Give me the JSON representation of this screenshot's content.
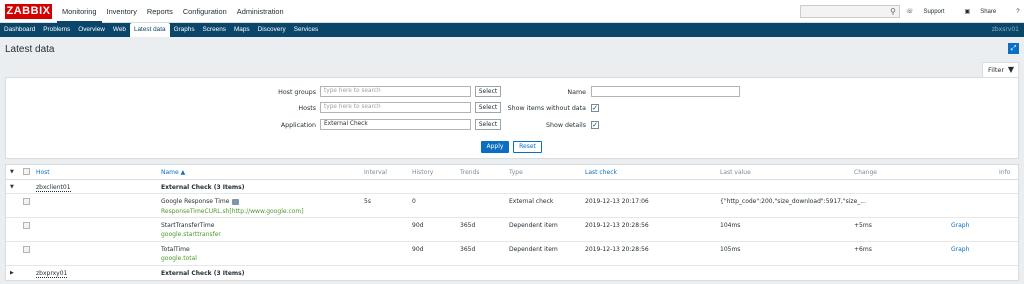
{
  "header": {
    "logo": "ZABBIX",
    "menu": [
      "Monitoring",
      "Inventory",
      "Reports",
      "Configuration",
      "Administration"
    ],
    "support": "Support",
    "share": "Share",
    "help": "?"
  },
  "subnav": {
    "items": [
      "Dashboard",
      "Problems",
      "Overview",
      "Web",
      "Latest data",
      "Graphs",
      "Screens",
      "Maps",
      "Discovery",
      "Services"
    ],
    "user": "zbxsrv01"
  },
  "page": {
    "title": "Latest data"
  },
  "filter": {
    "tab_label": "Filter",
    "host_groups_label": "Host groups",
    "host_groups_placeholder": "type here to search",
    "hosts_label": "Hosts",
    "hosts_placeholder": "type here to search",
    "application_label": "Application",
    "application_value": "External Check",
    "select_label": "Select",
    "name_label": "Name",
    "name_value": "",
    "show_without_data_label": "Show items without data",
    "show_details_label": "Show details",
    "apply_label": "Apply",
    "reset_label": "Reset"
  },
  "table": {
    "headers": {
      "host": "Host",
      "name": "Name ▲",
      "interval": "Interval",
      "history": "History",
      "trends": "Trends",
      "type": "Type",
      "last_check": "Last check",
      "last_value": "Last value",
      "change": "Change",
      "info": "Info"
    },
    "groups": [
      {
        "host": "zbxclient01",
        "app": "External Check (3 Items)"
      },
      {
        "host": "zbxprxy01",
        "app": "External Check (3 Items)"
      }
    ],
    "items": [
      {
        "name": "Google Response Time",
        "key": "ResponseTimeCURL.sh[http://www.google.com]",
        "interval": "5s",
        "history": "0",
        "trends": "",
        "type": "External check",
        "last_check": "2019-12-13 20:17:06",
        "last_value": "{\"http_code\":200,\"size_download\":5917,\"size_...",
        "change": "",
        "graph": ""
      },
      {
        "name": "StartTransferTime",
        "key": "google.starttransfer",
        "interval": "",
        "history": "90d",
        "trends": "365d",
        "type": "Dependent item",
        "last_check": "2019-12-13 20:28:56",
        "last_value": "104ms",
        "change": "+5ms",
        "graph": "Graph"
      },
      {
        "name": "TotalTime",
        "key": "google.total",
        "interval": "",
        "history": "90d",
        "trends": "365d",
        "type": "Dependent item",
        "last_check": "2019-12-13 20:28:56",
        "last_value": "105ms",
        "change": "+6ms",
        "graph": "Graph"
      }
    ]
  },
  "colors": {
    "brand": "#d40000",
    "nav": "#0a466a",
    "accent": "#0a6fc2",
    "green": "#4c9a2a"
  }
}
